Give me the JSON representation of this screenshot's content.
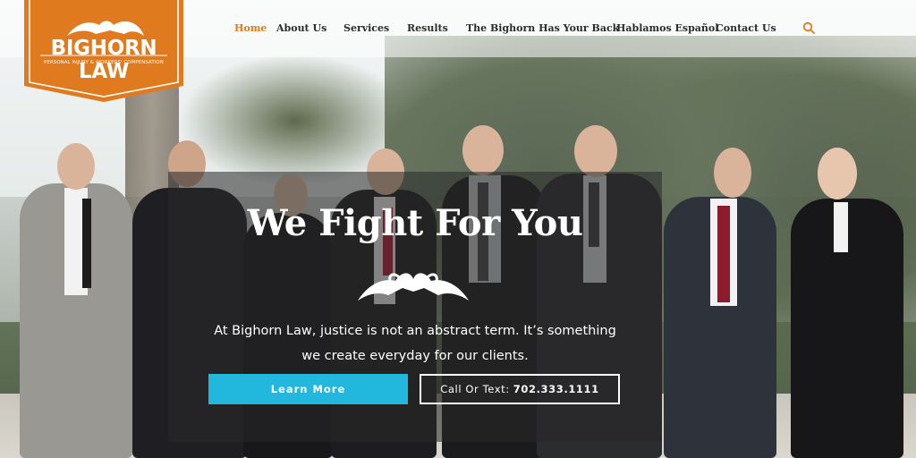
{
  "logo": {
    "name": "BIGHORN LAW",
    "tagline": "PERSONAL INJURY & WORKERS' COMPENSATION",
    "color": "#e07a1f"
  },
  "nav": {
    "items": [
      {
        "label": "Home",
        "active": true
      },
      {
        "label": "About Us",
        "active": false
      },
      {
        "label": "Services",
        "active": false
      },
      {
        "label": "Results",
        "active": false
      },
      {
        "label": "The Bighorn Has Your Back",
        "active": false
      },
      {
        "label": "Hablamos Español",
        "active": false
      },
      {
        "label": "Contact Us",
        "active": false
      }
    ],
    "search_icon": "search-icon",
    "active_color": "#e07a1f"
  },
  "hero": {
    "headline": "We Fight For You",
    "body_line1": "At Bighorn Law, justice is not an abstract term. It’s something",
    "body_line2": "we create everyday for our clients.",
    "learn_more_label": "Learn More",
    "call_label": "Call Or Text:",
    "call_number": "702.333.1111",
    "accent_color": "#22b7dc"
  }
}
